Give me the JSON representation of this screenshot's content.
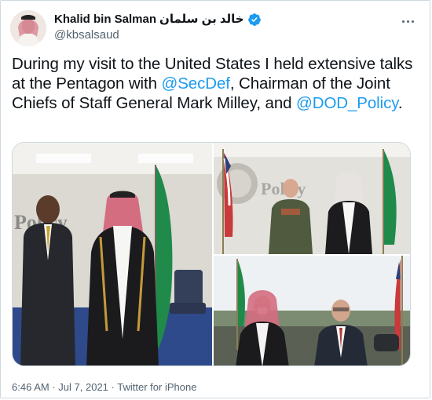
{
  "author": {
    "name": "Khalid bin Salman",
    "name_ar": "خالد بن سلمان",
    "handle": "@kbsalsaud"
  },
  "tweet": {
    "text_1": "During my visit to the United States I held extensive talks at the Pentagon with ",
    "mention_1": "@SecDef",
    "text_2": ", Chairman of the Joint Chiefs of Staff General Mark Milley, and ",
    "mention_2": "@DOD_Policy",
    "text_3": "."
  },
  "meta": {
    "time": "6:46 AM",
    "separator": "·",
    "date": "Jul 7, 2021",
    "source": "Twitter for iPhone"
  },
  "photos": {
    "wall_text": "Policy"
  },
  "colors": {
    "link": "#1d9bf0",
    "verified": "#1d9bf0",
    "muted": "#536471"
  }
}
